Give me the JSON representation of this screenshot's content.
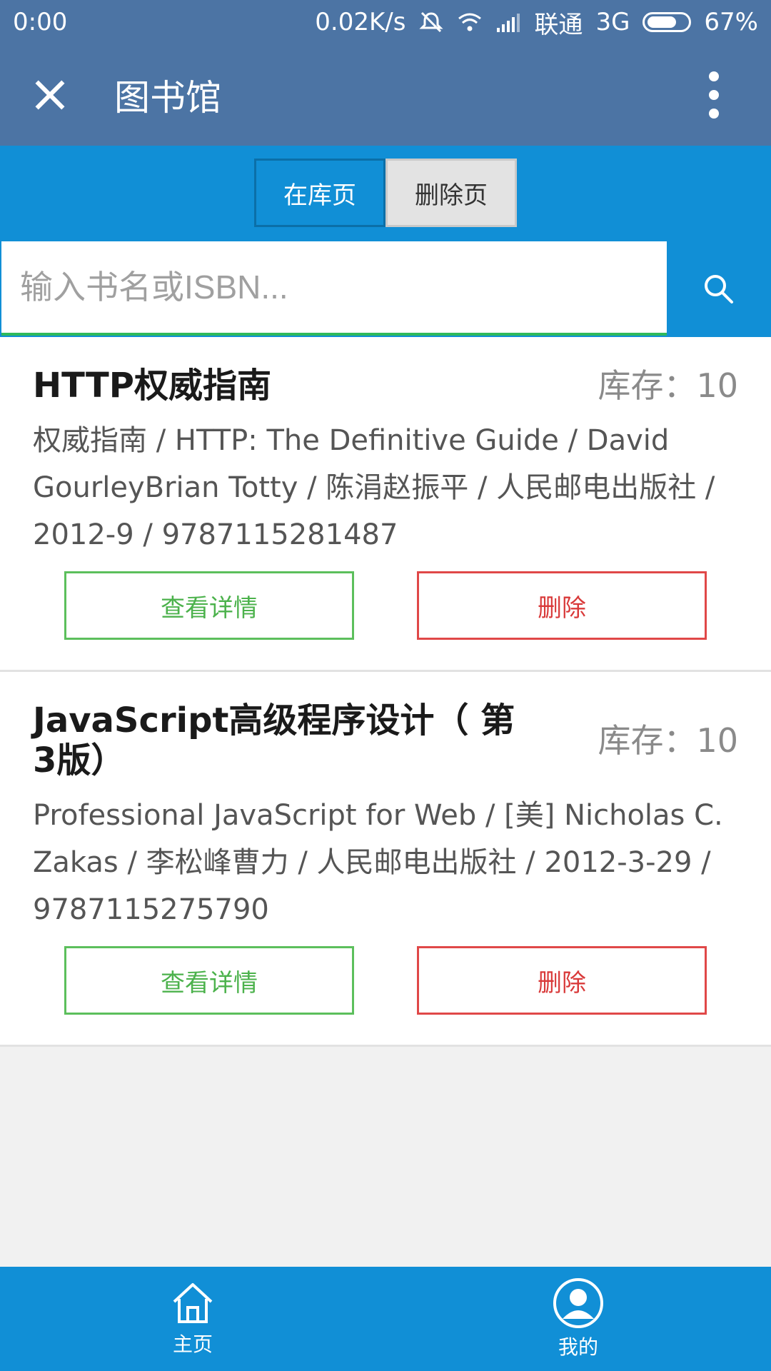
{
  "status_bar": {
    "time": "0:00",
    "speed": "0.02K/s",
    "carrier": "联通",
    "network": "3G",
    "battery": "67%"
  },
  "title_bar": {
    "title": "图书馆",
    "close_icon": "close-icon",
    "more_icon": "more-vert-icon"
  },
  "tabs": [
    {
      "label": "在库页",
      "active": true
    },
    {
      "label": "删除页",
      "active": false
    }
  ],
  "search": {
    "placeholder": "输入书名或ISBN...",
    "value": ""
  },
  "books": [
    {
      "title": "HTTP权威指南",
      "stock_label": "库存：",
      "stock": "10",
      "info": "权威指南 / HTTP: The Definitive Guide / David GourleyBrian Totty / 陈涓赵振平 / 人民邮电出版社 / 2012-9 / 9787115281487",
      "detail_label": "查看详情",
      "delete_label": "删除"
    },
    {
      "title": "JavaScript高级程序设计（ 第3版）",
      "stock_label": "库存：",
      "stock": "10",
      "info": "Professional JavaScript for Web / [美] Nicholas C. Zakas / 李松峰曹力 / 人民邮电出版社 / 2012-3-29 / 9787115275790",
      "detail_label": "查看详情",
      "delete_label": "删除"
    }
  ],
  "bottom_nav": [
    {
      "label": "主页",
      "icon": "home-icon"
    },
    {
      "label": "我的",
      "icon": "user-icon"
    }
  ],
  "colors": {
    "header": "#4c74a4",
    "primary": "#118fd6",
    "detail_border": "#5cbf5c",
    "delete_border": "#e04848"
  }
}
